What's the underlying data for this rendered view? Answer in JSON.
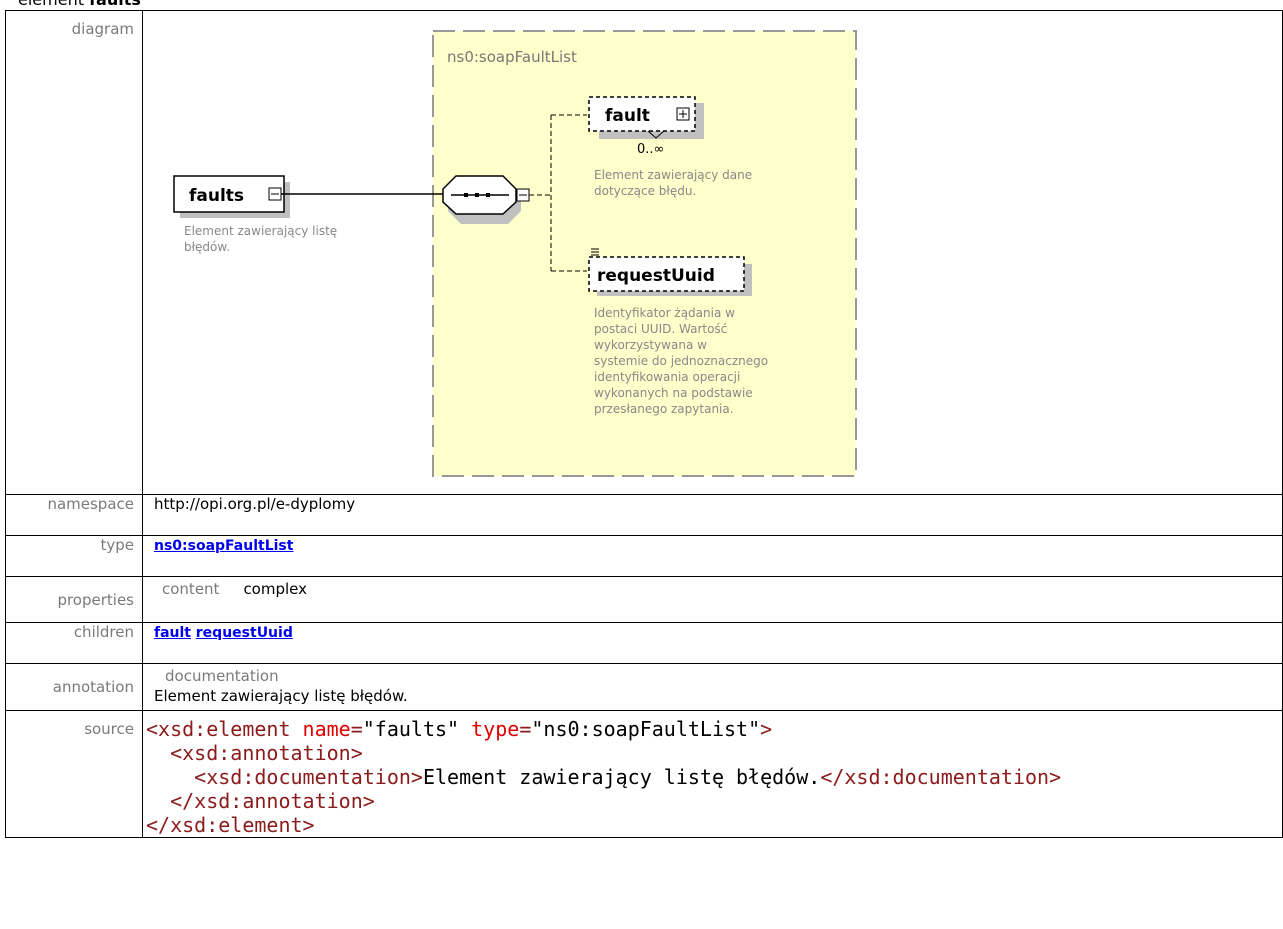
{
  "page": {
    "title_prefix": "element",
    "title_name": "faults"
  },
  "rows": {
    "diagram_label": "diagram",
    "namespace_label": "namespace",
    "namespace_value": "http://opi.org.pl/e-dyplomy",
    "type_label": "type",
    "type_value": "ns0:soapFaultList",
    "properties_label": "properties",
    "properties_key": "content",
    "properties_value": "complex",
    "children_label": "children",
    "children": [
      "fault",
      "requestUuid"
    ],
    "annotation_label": "annotation",
    "annotation_key": "documentation",
    "annotation_value": "Element zawierający listę błędów.",
    "source_label": "source"
  },
  "diagram": {
    "type_name": "ns0:soapFaultList",
    "root_element": "faults",
    "root_doc": [
      "Element zawierający listę",
      "błędów."
    ],
    "child_fault": "fault",
    "fault_occurs": "0..∞",
    "fault_doc": [
      "Element zawierający dane",
      "dotyczące błędu."
    ],
    "child_request": "requestUuid",
    "request_doc": [
      "Identyfikator żądania w",
      "postaci UUID. Wartość",
      "wykorzystywana w",
      "systemie do jednoznacznego",
      "identyfikowania operacji",
      "wykonanych na podstawie",
      "przesłanego zapytania."
    ]
  },
  "source": {
    "line1_open": "<xsd:element",
    "line1_attr1": "name",
    "line1_val1": "\"faults\"",
    "line1_attr2": "type",
    "line1_val2": "\"ns0:soapFaultList\"",
    "line1_close": ">",
    "line2": "<xsd:annotation>",
    "line3_open": "<xsd:documentation>",
    "line3_text": "Element zawierający listę błędów.",
    "line3_close": "</xsd:documentation>",
    "line4": "</xsd:annotation>",
    "line5": "</xsd:element>",
    "eq": "="
  }
}
